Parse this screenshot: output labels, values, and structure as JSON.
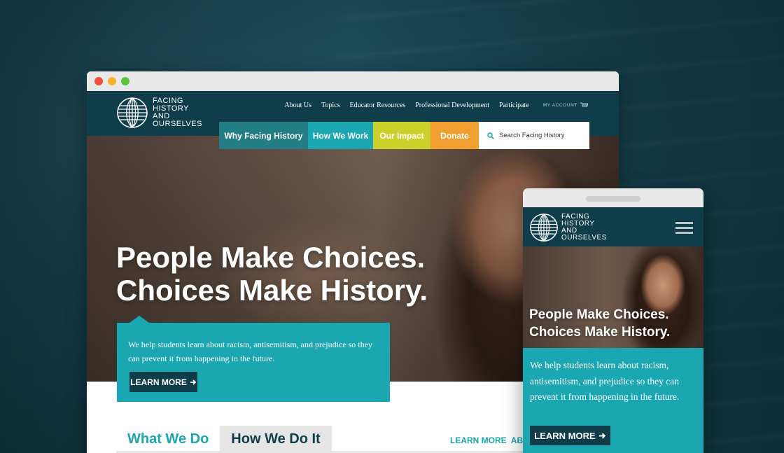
{
  "brand": {
    "logo_lines": [
      "FACING",
      "HISTORY",
      "AND",
      "OURSELVES"
    ],
    "colors": {
      "navy": "#0f3d4a",
      "teal": "#1aa7b2",
      "dark_teal": "#237d84",
      "yellow": "#cdd02a",
      "orange": "#f0a030"
    }
  },
  "top_nav": {
    "items": [
      "About Us",
      "Topics",
      "Educator Resources",
      "Professional Development",
      "Participate"
    ],
    "account": "MY ACCOUNT",
    "account_icon": "cart-icon"
  },
  "main_nav": {
    "items": [
      "Why Facing History",
      "How We Work",
      "Our Impact",
      "Donate"
    ],
    "search_placeholder": "Search Facing History",
    "search_icon": "search-icon"
  },
  "hero": {
    "headline_line1": "People Make Choices.",
    "headline_line2": "Choices Make History.",
    "body": "We help students learn about racism, antisemitism, and prejudice so they can prevent it from happening in the future.",
    "button": "LEARN MORE",
    "button_icon": "arrow-right-icon"
  },
  "tabs": {
    "items": [
      "What We Do",
      "How We Do It"
    ],
    "link": "LEARN MORE  ABOUT"
  },
  "mobile": {
    "headline_line1": "People Make Choices.",
    "headline_line2": "Choices Make History.",
    "body": "We help students learn about racism, antisemitism, and prejudice so they can prevent it from happening in the future.",
    "button": "LEARN MORE",
    "menu_icon": "hamburger-icon"
  }
}
